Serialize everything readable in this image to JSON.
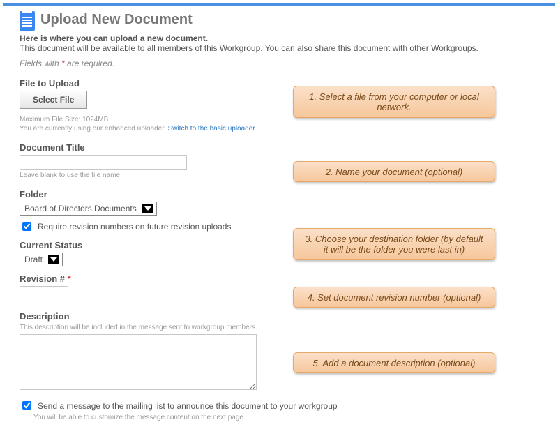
{
  "header": {
    "title": "Upload New Document",
    "intro1": "Here is where you can upload a new document.",
    "intro2": "This document will be available to all members of this Workgroup. You can also share this document with other Workgroups.",
    "fields_with_prefix": "Fields with ",
    "fields_with_suffix": " are required.",
    "asterisk": "*"
  },
  "upload": {
    "label": "File to Upload",
    "button": "Select File",
    "max_size": "Maximum File Size: 1024MB",
    "enhanced_text": "You are currently using our enhanced uploader. ",
    "switch_link": "Switch to the basic uploader"
  },
  "title_field": {
    "label": "Document Title",
    "hint": "Leave blank to use the file name."
  },
  "folder": {
    "label": "Folder",
    "selected": "Board of Directors Documents",
    "require_revision": "Require revision numbers on future revision uploads"
  },
  "status": {
    "label": "Current Status",
    "selected": "Draft"
  },
  "revision": {
    "label_prefix": "Revision # ",
    "asterisk": "*"
  },
  "description": {
    "label": "Description",
    "hint": "This description will be included in the message sent to workgroup members."
  },
  "announce": {
    "label": "Send a message to the mailing list to announce this document to your workgroup",
    "hint": "You will be able to customize the message content on the next page."
  },
  "callouts": {
    "c1": "1. Select a file from your computer or local network.",
    "c2": "2. Name your document (optional)",
    "c3": "3. Choose your destination folder (by default it will be the folder you were last in)",
    "c4": "4. Set document revision number (optional)",
    "c5": "5. Add a document description (optional)"
  }
}
